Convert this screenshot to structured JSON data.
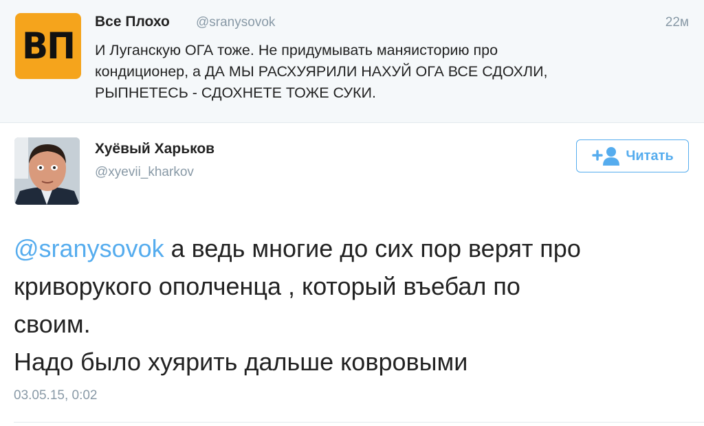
{
  "parent_tweet": {
    "avatar_text": "ВП",
    "avatar_color": "#f5a41c",
    "name": "Все Плохо",
    "handle": "@sranysovok",
    "time": "22м",
    "lines": [
      "И Луганскую ОГА тоже. Не придумывать маняисторию про",
      "кондиционер, а ДА МЫ РАСХУЯРИЛИ НАХУЙ ОГА ВСЕ СДОХЛИ,",
      "РЫПНЕТЕСЬ - СДОХНЕТЕ ТОЖЕ СУКИ."
    ]
  },
  "main_tweet": {
    "name": "Хуёвый Харьков",
    "handle": "@xyevii_kharkov",
    "follow_label": "Читать",
    "follow_icon": "add-user-icon",
    "mention": "@sranysovok",
    "lines": [
      " а ведь многие до сих пор верят про",
      "криворукого ополченца , который въебал по",
      "своим.",
      "Надо было хуярить дальше ковровыми"
    ],
    "date": "03.05.15, 0:02"
  },
  "colors": {
    "accent": "#55acee",
    "muted": "#8899a6",
    "parent_bg": "#f5f8fa"
  }
}
